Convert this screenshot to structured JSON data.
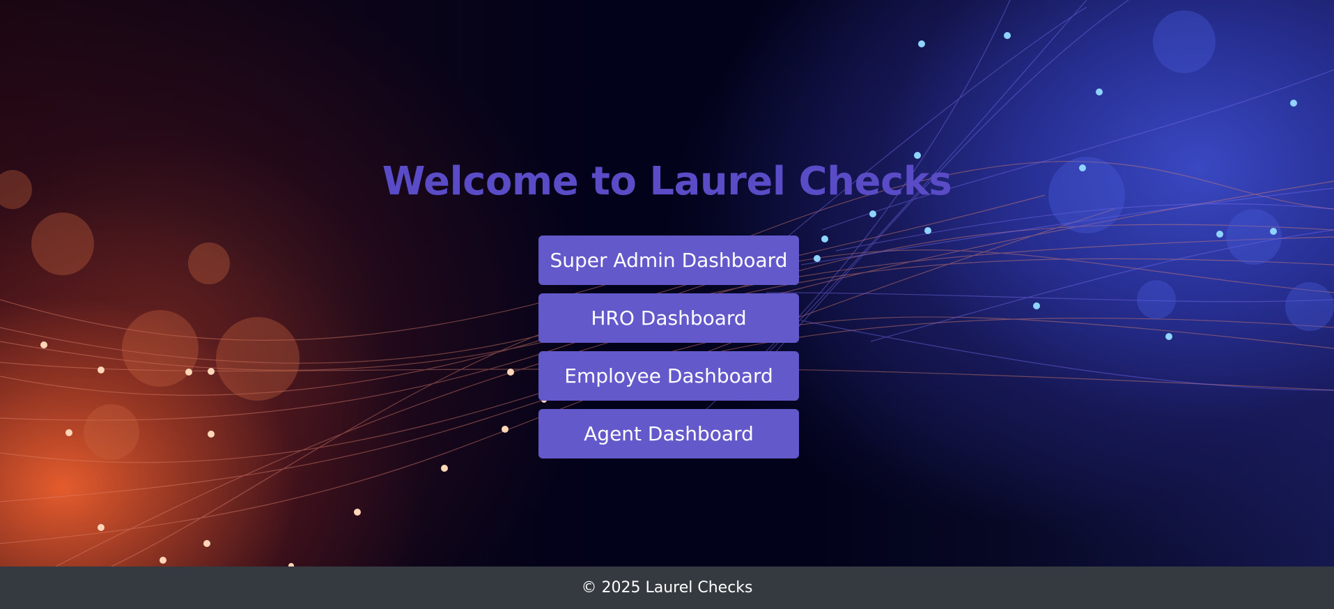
{
  "header": {
    "title": "Welcome to Laurel Checks"
  },
  "dashboards": [
    {
      "label": "Super Admin Dashboard"
    },
    {
      "label": "HRO Dashboard"
    },
    {
      "label": "Employee Dashboard"
    },
    {
      "label": "Agent Dashboard"
    }
  ],
  "footer": {
    "copyright": "© 2025 Laurel Checks"
  },
  "colors": {
    "accent": "#6459cb",
    "title": "#5a4cc6",
    "footer_bg": "#353a40",
    "warm_glow": "#ee602e",
    "cool_glow": "#3c4bc8"
  }
}
